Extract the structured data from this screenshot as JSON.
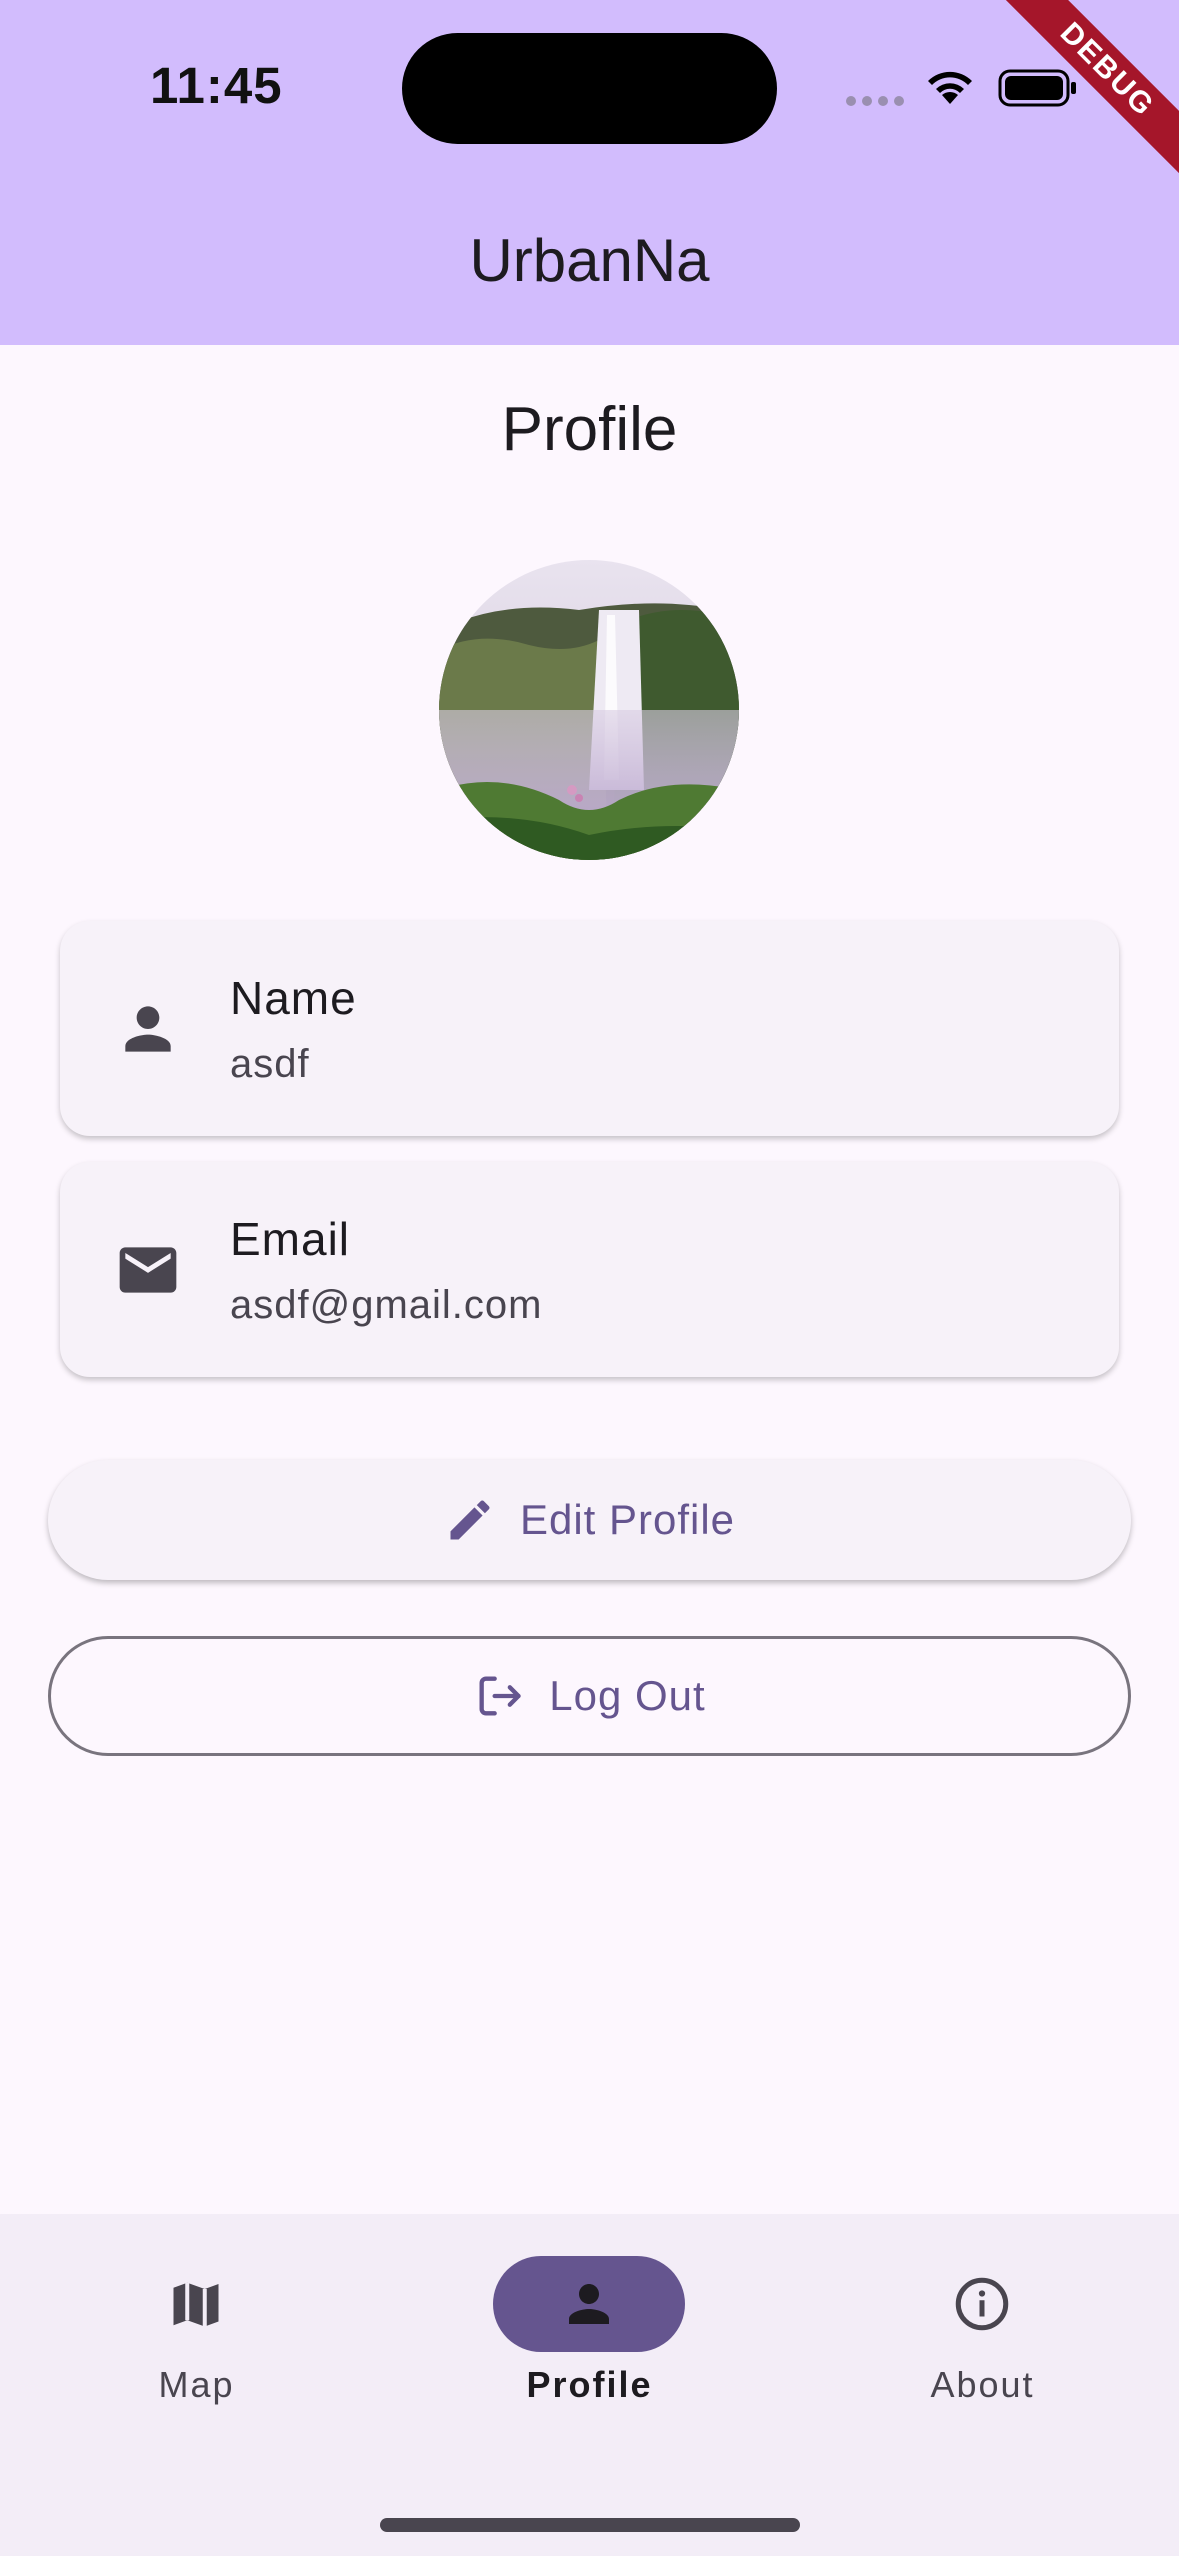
{
  "status_bar": {
    "time": "11:45",
    "debug_label": "DEBUG"
  },
  "app_bar": {
    "title": "UrbanNa"
  },
  "page": {
    "title": "Profile"
  },
  "profile": {
    "name_label": "Name",
    "name_value": "asdf",
    "email_label": "Email",
    "email_value": "asdf@gmail.com"
  },
  "actions": {
    "edit_label": "Edit Profile",
    "logout_label": "Log Out"
  },
  "bottom_nav": {
    "items": [
      {
        "label": "Map",
        "icon": "map-icon",
        "selected": false
      },
      {
        "label": "Profile",
        "icon": "person-icon",
        "selected": true
      },
      {
        "label": "About",
        "icon": "info-icon",
        "selected": false
      }
    ]
  },
  "colors": {
    "app_bar": "#d2bcfd",
    "background": "#fdf7fe",
    "primary": "#65558f",
    "card": "#f7f2f9",
    "nav_bar": "#f3edf7",
    "debug_banner": "#a5162a"
  }
}
